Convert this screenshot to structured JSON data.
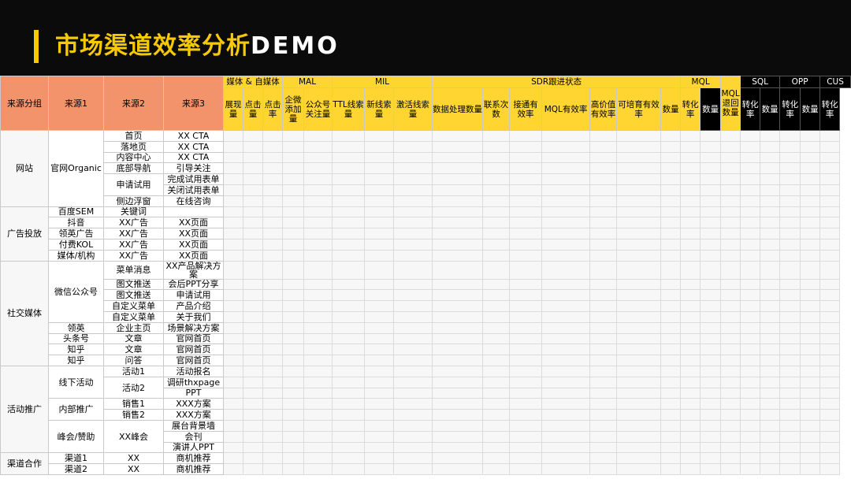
{
  "title": "市场渠道效率分析",
  "title_latin": "DEMO",
  "header": {
    "left": [
      "来源分组",
      "来源1",
      "来源2",
      "来源3"
    ],
    "groups": [
      {
        "label": "媒体 & 自媒体",
        "span": 3,
        "style": "yellow"
      },
      {
        "label": "MAL",
        "span": 2,
        "style": "yellow"
      },
      {
        "label": "MIL",
        "span": 3,
        "style": "yellow"
      },
      {
        "label": "SDR跟进状态",
        "span": 7,
        "style": "yellow"
      },
      {
        "label": "MQL",
        "span": 2,
        "style": "yellow"
      },
      {
        "label": "",
        "span": 1,
        "style": "yellow"
      },
      {
        "label": "SQL",
        "span": 2,
        "style": "black"
      },
      {
        "label": "OPP",
        "span": 2,
        "style": "black"
      },
      {
        "label": "CUS",
        "span": 2,
        "style": "black"
      }
    ],
    "subs": [
      "展现量",
      "点击量",
      "点击率",
      "企微添加量",
      "公众号关注量",
      "TTL线索量",
      "新线索量",
      "激活线索量",
      "数据处理数量",
      "联系次数",
      "接通有效率",
      "MQL有效率",
      "高价值有效率",
      "可培育有效率",
      "数量",
      "转化率",
      "MQL退回数量",
      "数量",
      "转化率",
      "数量",
      "转化率",
      "数量",
      "转化率"
    ]
  },
  "rows": [
    [
      "网站",
      "官网Organic",
      "首页",
      "XX CTA"
    ],
    [
      "",
      "",
      "落地页",
      "XX CTA"
    ],
    [
      "",
      "",
      "内容中心",
      "XX CTA"
    ],
    [
      "",
      "",
      "底部导航",
      "引导关注"
    ],
    [
      "",
      "",
      "申请试用",
      "完成试用表单"
    ],
    [
      "",
      "",
      "",
      "关闭试用表单"
    ],
    [
      "",
      "",
      "侧边浮窗",
      "在线咨询"
    ],
    [
      "广告投放",
      "百度SEM",
      "关键词",
      ""
    ],
    [
      "",
      "抖音",
      "XX广告",
      "XX页面"
    ],
    [
      "",
      "领英广告",
      "XX广告",
      "XX页面"
    ],
    [
      "",
      "付费KOL",
      "XX广告",
      "XX页面"
    ],
    [
      "",
      "媒体/机构",
      "XX广告",
      "XX页面"
    ],
    [
      "社交媒体",
      "微信公众号",
      "菜单消息",
      "XX产品解决方案"
    ],
    [
      "",
      "",
      "图文推送",
      "会后PPT分享"
    ],
    [
      "",
      "",
      "图文推送",
      "申请试用"
    ],
    [
      "",
      "",
      "自定义菜单",
      "产品介绍"
    ],
    [
      "",
      "",
      "自定义菜单",
      "关于我们"
    ],
    [
      "",
      "领英",
      "企业主页",
      "场景解决方案"
    ],
    [
      "",
      "头条号",
      "文章",
      "官网首页"
    ],
    [
      "",
      "知乎",
      "文章",
      "官网首页"
    ],
    [
      "",
      "知乎",
      "问答",
      "官网首页"
    ],
    [
      "活动推广",
      "线下活动",
      "活动1",
      "活动报名"
    ],
    [
      "",
      "",
      "活动2",
      "调研thxpage"
    ],
    [
      "",
      "",
      "",
      "PPT"
    ],
    [
      "",
      "内部推广",
      "销售1",
      "XXX方案"
    ],
    [
      "",
      "",
      "销售2",
      "XXX方案"
    ],
    [
      "",
      "峰会/赞助",
      "XX峰会",
      "展台背景墙"
    ],
    [
      "",
      "",
      "",
      "会刊"
    ],
    [
      "",
      "",
      "",
      "演讲人PPT"
    ],
    [
      "渠道合作",
      "渠道1",
      "XX",
      "商机推荐"
    ],
    [
      "",
      "渠道2",
      "XX",
      "商机推荐"
    ]
  ],
  "colors": {
    "header_bg": "#0b0b0b",
    "accent": "#f6c900",
    "left_header": "#f2936b",
    "yellow_header": "#ffd631",
    "black_header": "#000000"
  }
}
